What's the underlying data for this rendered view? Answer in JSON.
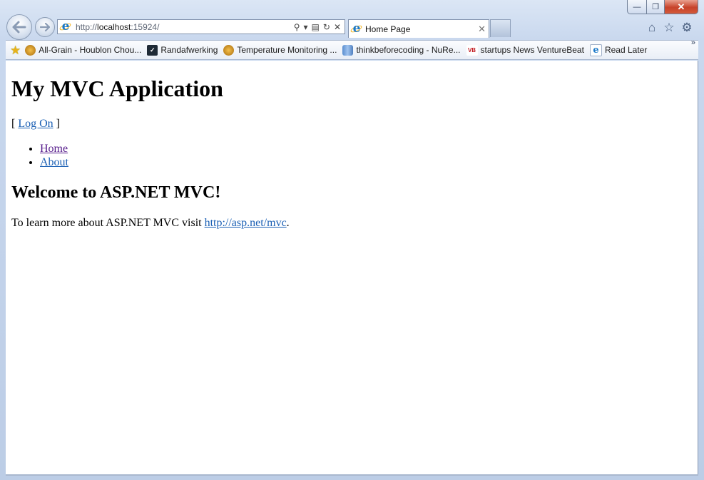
{
  "browser": {
    "address": {
      "prefix": "http://",
      "host": "localhost",
      "rest": ":15924/"
    },
    "tab_title": "Home Page",
    "favorites": [
      {
        "label": "All-Grain - Houblon Chou...",
        "icon": "beer-icon"
      },
      {
        "label": "Randafwerking",
        "icon": "check-icon"
      },
      {
        "label": "Temperature Monitoring ...",
        "icon": "beer-icon"
      },
      {
        "label": "thinkbeforecoding - NuRe...",
        "icon": "can-icon"
      },
      {
        "label": "startups News  VentureBeat",
        "icon": "vb-icon"
      },
      {
        "label": "Read Later",
        "icon": "ie-icon"
      }
    ],
    "more_chevron": "»"
  },
  "page": {
    "title": "My MVC Application",
    "logon_open": "[ ",
    "logon_link": "Log On",
    "logon_close": " ]",
    "menu": [
      {
        "label": "Home"
      },
      {
        "label": "About"
      }
    ],
    "welcome": "Welcome to ASP.NET MVC!",
    "learn_text": "To learn more about ASP.NET MVC visit ",
    "learn_link": "http://asp.net/mvc",
    "learn_end": "."
  },
  "colors": {
    "link": "#1a5fb4",
    "visited": "#551a8b",
    "chrome": "#c4d3ea"
  }
}
